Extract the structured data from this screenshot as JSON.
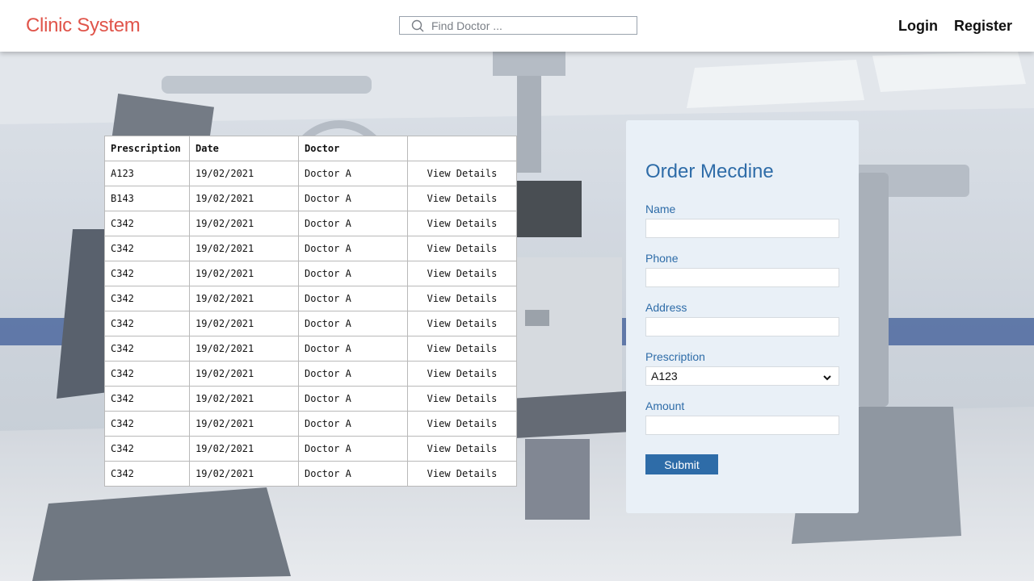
{
  "header": {
    "brand": "Clinic System",
    "search_placeholder": "Find Doctor ...",
    "login": "Login",
    "register": "Register"
  },
  "table": {
    "headers": [
      "Prescription",
      "Date",
      "Doctor",
      ""
    ],
    "rows": [
      {
        "prescription": "A123",
        "date": "19/02/2021",
        "doctor": "Doctor A",
        "action": "View Details"
      },
      {
        "prescription": "B143",
        "date": "19/02/2021",
        "doctor": "Doctor A",
        "action": "View Details"
      },
      {
        "prescription": "C342",
        "date": "19/02/2021",
        "doctor": "Doctor A",
        "action": "View Details"
      },
      {
        "prescription": "C342",
        "date": "19/02/2021",
        "doctor": "Doctor A",
        "action": "View Details"
      },
      {
        "prescription": "C342",
        "date": "19/02/2021",
        "doctor": "Doctor A",
        "action": "View Details"
      },
      {
        "prescription": "C342",
        "date": "19/02/2021",
        "doctor": "Doctor A",
        "action": "View Details"
      },
      {
        "prescription": "C342",
        "date": "19/02/2021",
        "doctor": "Doctor A",
        "action": "View Details"
      },
      {
        "prescription": "C342",
        "date": "19/02/2021",
        "doctor": "Doctor A",
        "action": "View Details"
      },
      {
        "prescription": "C342",
        "date": "19/02/2021",
        "doctor": "Doctor A",
        "action": "View Details"
      },
      {
        "prescription": "C342",
        "date": "19/02/2021",
        "doctor": "Doctor A",
        "action": "View Details"
      },
      {
        "prescription": "C342",
        "date": "19/02/2021",
        "doctor": "Doctor A",
        "action": "View Details"
      },
      {
        "prescription": "C342",
        "date": "19/02/2021",
        "doctor": "Doctor A",
        "action": "View Details"
      },
      {
        "prescription": "C342",
        "date": "19/02/2021",
        "doctor": "Doctor A",
        "action": "View Details"
      }
    ]
  },
  "order_form": {
    "title": "Order Mecdine",
    "name_label": "Name",
    "name_value": "",
    "phone_label": "Phone",
    "phone_value": "",
    "address_label": "Address",
    "address_value": "",
    "prescription_label": "Prescription",
    "prescription_value": "A123",
    "amount_label": "Amount",
    "amount_value": "",
    "submit": "Submit"
  },
  "icons": {
    "search": "search-icon",
    "dropdown": "chevron-down-icon"
  },
  "colors": {
    "brand": "#e0544a",
    "accent": "#2e6ca8",
    "card_bg": "#e9f0f7"
  }
}
